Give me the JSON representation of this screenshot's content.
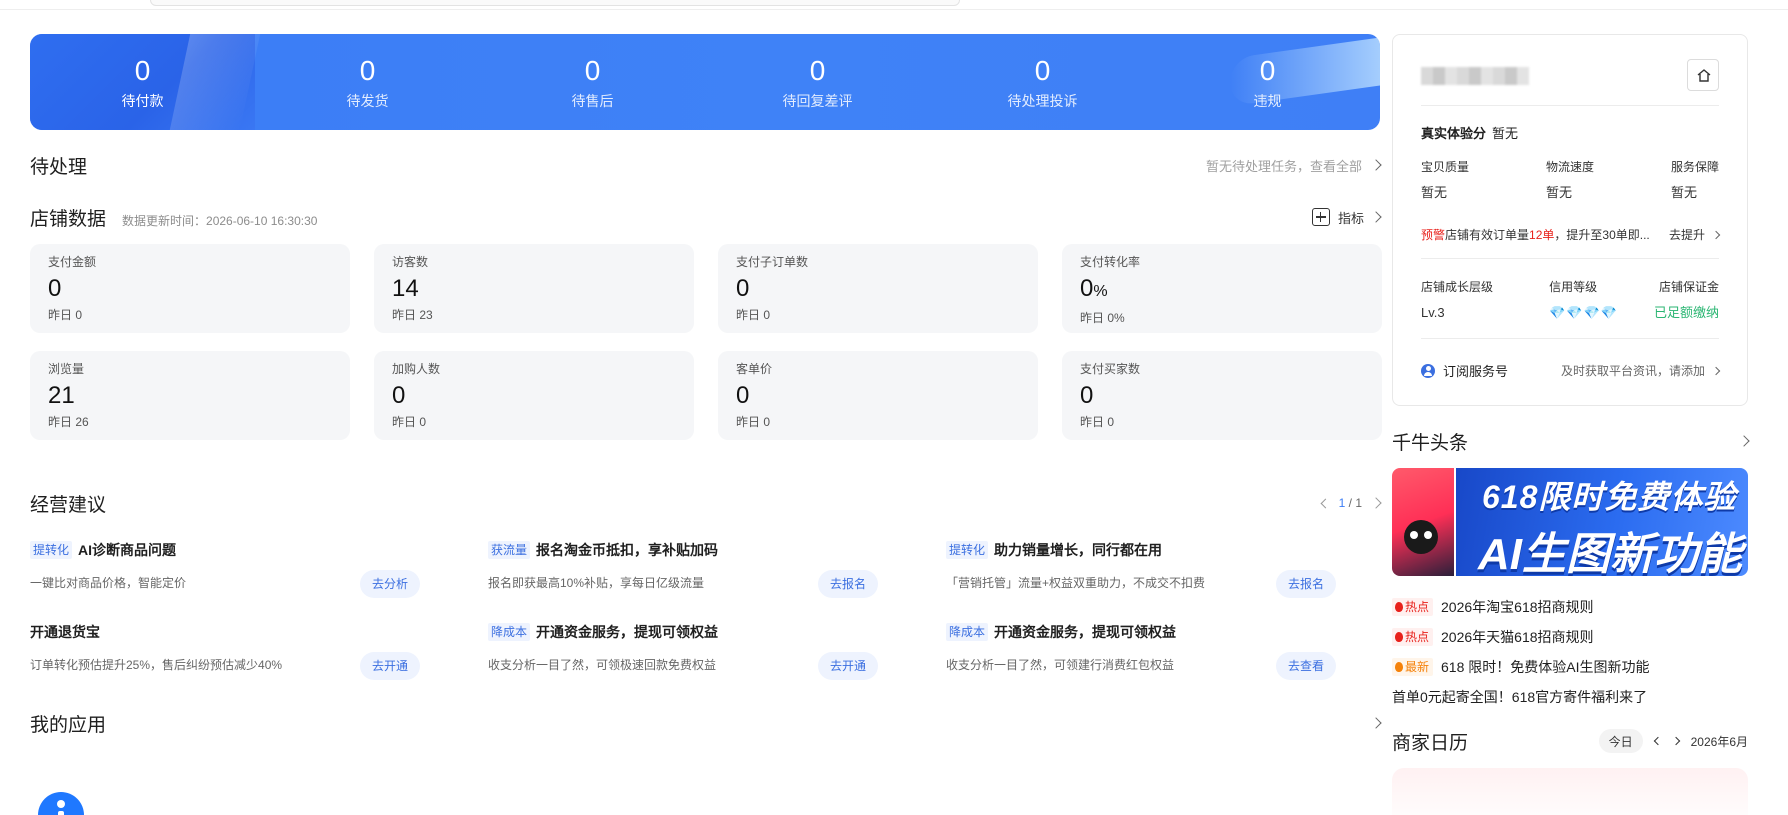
{
  "order_stats": [
    {
      "value": "0",
      "label": "待付款"
    },
    {
      "value": "0",
      "label": "待发货"
    },
    {
      "value": "0",
      "label": "待售后"
    },
    {
      "value": "0",
      "label": "待回复差评"
    },
    {
      "value": "0",
      "label": "待处理投诉"
    },
    {
      "value": "0",
      "label": "违规"
    }
  ],
  "pending": {
    "title": "待处理",
    "link": "暂无待处理任务，查看全部"
  },
  "shop_data": {
    "title": "店铺数据",
    "update_time": "数据更新时间：2026-06-10 16:30:30",
    "metric_action": "指标",
    "metrics": [
      {
        "label": "支付金额",
        "value": "0",
        "unit": "",
        "prev": "昨日 0"
      },
      {
        "label": "访客数",
        "value": "14",
        "unit": "",
        "prev": "昨日 23"
      },
      {
        "label": "支付子订单数",
        "value": "0",
        "unit": "",
        "prev": "昨日 0"
      },
      {
        "label": "支付转化率",
        "value": "0",
        "unit": "%",
        "prev": "昨日 0%"
      },
      {
        "label": "浏览量",
        "value": "21",
        "unit": "",
        "prev": "昨日 26"
      },
      {
        "label": "加购人数",
        "value": "0",
        "unit": "",
        "prev": "昨日 0"
      },
      {
        "label": "客单价",
        "value": "0",
        "unit": "",
        "prev": "昨日 0"
      },
      {
        "label": "支付买家数",
        "value": "0",
        "unit": "",
        "prev": "昨日 0"
      }
    ]
  },
  "advice": {
    "title": "经营建议",
    "pager_current": "1",
    "pager_total": "/ 1",
    "items": [
      {
        "tag": "提转化",
        "title": "AI诊断商品问题",
        "desc": "一键比对商品价格，智能定价",
        "button": "去分析"
      },
      {
        "tag": "获流量",
        "title": "报名淘金币抵扣，享补贴加码",
        "desc": "报名即获最高10%补贴，享每日亿级流量",
        "button": "去报名"
      },
      {
        "tag": "提转化",
        "title": "助力销量增长，同行都在用",
        "desc": "「营销托管」流量+权益双重助力，不成交不扣费",
        "button": "去报名"
      },
      {
        "tag": "",
        "title": "开通退货宝",
        "desc": "订单转化预估提升25%，售后纠纷预估减少40%",
        "button": "去开通"
      },
      {
        "tag": "降成本",
        "title": "开通资金服务，提现可领权益",
        "desc": "收支分析一目了然，可领极速回款免费权益",
        "button": "去开通"
      },
      {
        "tag": "降成本",
        "title": "开通资金服务，提现可领权益",
        "desc": "收支分析一目了然，可领建行消费红包权益",
        "button": "去查看"
      }
    ]
  },
  "my_apps": {
    "title": "我的应用"
  },
  "score_card": {
    "real_score_label": "真实体验分",
    "real_score_value": "暂无",
    "dimensions": [
      {
        "label": "宝贝质量",
        "value": "暂无"
      },
      {
        "label": "物流速度",
        "value": "暂无"
      },
      {
        "label": "服务保障",
        "value": "暂无"
      }
    ],
    "warning_tag": "预警",
    "warning_text_1": "店铺有效订单量",
    "warning_count": "12单",
    "warning_text_2": "，提升至30单即...",
    "warning_action": "去提升",
    "levels": [
      {
        "label": "店铺成长层级",
        "value": "Lv.3"
      },
      {
        "label": "信用等级",
        "value": "💎💎💎💎"
      },
      {
        "label": "店铺保证金",
        "value": "已足额缴纳"
      }
    ],
    "subscribe_label": "订阅服务号",
    "subscribe_hint": "及时获取平台资讯，请添加"
  },
  "news": {
    "title": "千牛头条",
    "banner_line1": "618限时免费体验",
    "banner_line2": "AI生图新功能",
    "items": [
      {
        "tag": "热点",
        "tag_type": "hot",
        "text": "2026年淘宝618招商规则"
      },
      {
        "tag": "热点",
        "tag_type": "hot",
        "text": "2026年天猫618招商规则"
      },
      {
        "tag": "最新",
        "tag_type": "new",
        "text": "618 限时！免费体验AI生图新功能"
      },
      {
        "tag": "",
        "tag_type": "",
        "text": "首单0元起寄全国！618官方寄件福利来了"
      }
    ]
  },
  "calendar": {
    "title": "商家日历",
    "today": "今日",
    "month": "2026年6月"
  },
  "colors": {
    "accent": "#3b7cf5",
    "warning_red": "#e8221c",
    "success_green": "#2bb673",
    "hot_orange": "#f5820b"
  }
}
